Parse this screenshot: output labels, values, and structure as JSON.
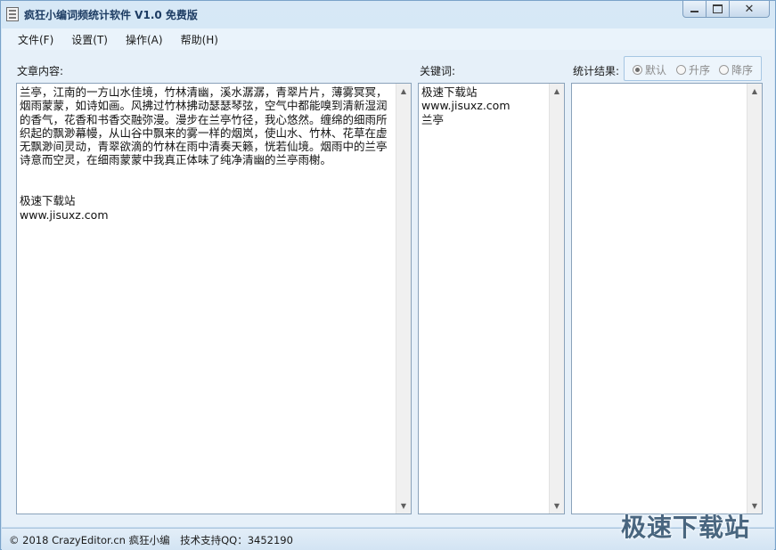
{
  "window": {
    "title": "疯狂小编词频统计软件 V1.0 免费版"
  },
  "menu": {
    "items": [
      "文件(F)",
      "设置(T)",
      "操作(A)",
      "帮助(H)"
    ]
  },
  "article": {
    "label": "文章内容:",
    "text": "兰亭，江南的一方山水佳境，竹林清幽，溪水潺潺，青翠片片，薄雾冥冥，烟雨蒙蒙，如诗如画。风拂过竹林拂动瑟瑟琴弦，空气中都能嗅到清新湿润的香气，花香和书香交融弥漫。漫步在兰亭竹径，我心悠然。缠绵的细雨所织起的飘渺幕幔，从山谷中飘来的雾一样的烟岚，使山水、竹林、花草在虚无飘渺间灵动，青翠欲滴的竹林在雨中清奏天籁，恍若仙境。烟雨中的兰亭诗意而空灵，在细雨蒙蒙中我真正体味了纯净清幽的兰亭雨榭。\n\n\n极速下载站\nwww.jisuxz.com"
  },
  "keywords": {
    "label": "关键词:",
    "text": "极速下载站\nwww.jisuxz.com\n兰亭"
  },
  "results": {
    "label": "统计结果:",
    "text": "",
    "sort_options": [
      {
        "label": "默认",
        "selected": true
      },
      {
        "label": "升序",
        "selected": false
      },
      {
        "label": "降序",
        "selected": false
      }
    ]
  },
  "status": {
    "text": "© 2018 CrazyEditor.cn 疯狂小编　技术支持QQ：3452190"
  },
  "watermark": {
    "text": "极速下载站"
  },
  "icons": {
    "app": "calculator-icon",
    "minimize": "minimize-icon",
    "maximize": "maximize-icon",
    "close": "close-icon"
  },
  "colors": {
    "title_text": "#1d3c63",
    "window_bg": "#d7e8f6",
    "menu_bg": "#eaf3fb"
  }
}
